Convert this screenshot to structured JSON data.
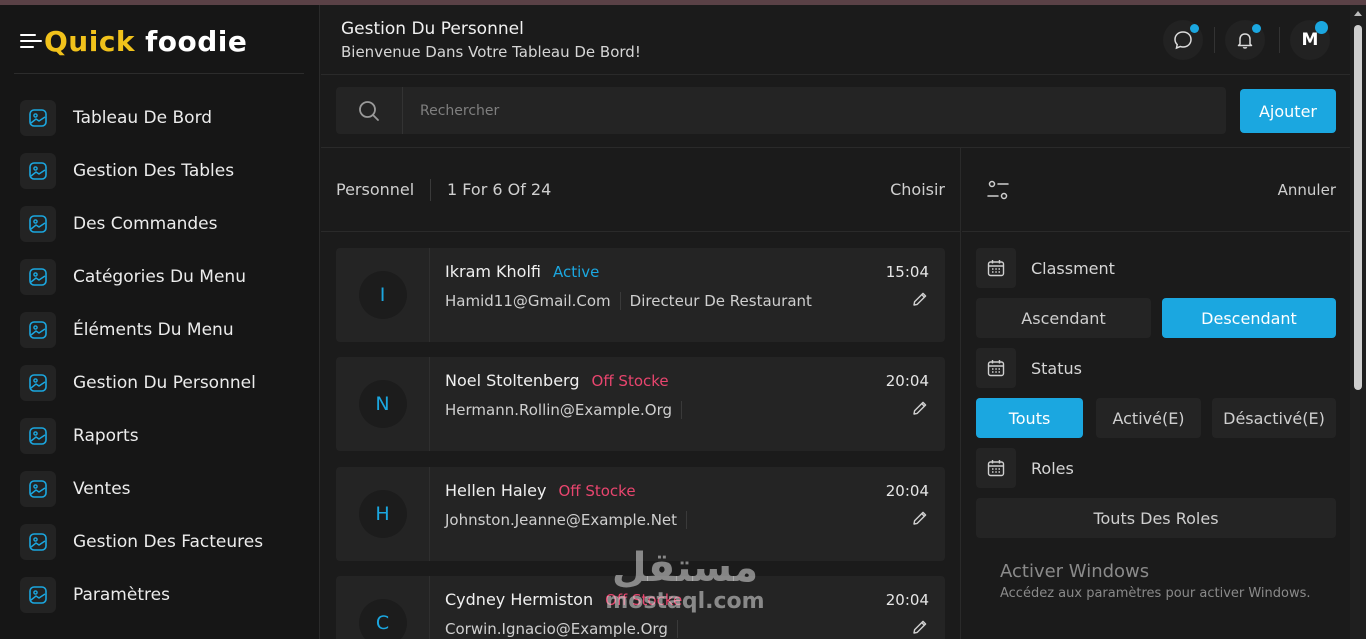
{
  "brand": {
    "part1": "Quick",
    "part2": "foodie"
  },
  "sidebar": {
    "items": [
      {
        "label": "Tableau De Bord"
      },
      {
        "label": "Gestion Des Tables"
      },
      {
        "label": "Des Commandes"
      },
      {
        "label": "Catégories Du Menu"
      },
      {
        "label": "Éléments Du Menu"
      },
      {
        "label": "Gestion Du Personnel"
      },
      {
        "label": "Raports"
      },
      {
        "label": "Ventes"
      },
      {
        "label": "Gestion Des Facteures"
      },
      {
        "label": "Paramètres"
      }
    ]
  },
  "header": {
    "title": "Gestion Du Personnel",
    "subtitle": "Bienvenue Dans Votre Tableau De Bord!",
    "avatar_letter": "M"
  },
  "search": {
    "placeholder": "Rechercher",
    "value": ""
  },
  "toolbar": {
    "add_label": "Ajouter"
  },
  "list": {
    "title": "Personnel",
    "count": "1 For 6 Of 24",
    "choose_label": "Choisir",
    "rows": [
      {
        "initial": "I",
        "name": "Ikram Kholfi",
        "status": "Active",
        "email": "Hamid11@Gmail.Com",
        "role": "Directeur De Restaurant",
        "time": "15:04"
      },
      {
        "initial": "N",
        "name": "Noel Stoltenberg",
        "status": "Off Stocke",
        "email": "Hermann.Rollin@Example.Org",
        "role": "",
        "time": "20:04"
      },
      {
        "initial": "H",
        "name": "Hellen Haley",
        "status": "Off Stocke",
        "email": "Johnston.Jeanne@Example.Net",
        "role": "",
        "time": "20:04"
      },
      {
        "initial": "C",
        "name": "Cydney Hermiston",
        "status": "Off Stocke",
        "email": "Corwin.Ignacio@Example.Org",
        "role": "",
        "time": "20:04"
      }
    ]
  },
  "filters": {
    "cancel_label": "Annuler",
    "sort": {
      "label": "Classment",
      "options": [
        "Ascendant",
        "Descendant"
      ],
      "selected": "Descendant"
    },
    "status": {
      "label": "Status",
      "options": [
        "Touts",
        "Activé(E)",
        "Désactivé(E)"
      ],
      "selected": "Touts"
    },
    "roles": {
      "label": "Roles",
      "selected": "Touts Des Roles"
    }
  },
  "system": {
    "activate_title": "Activer Windows",
    "activate_sub": "Accédez aux paramètres pour activer Windows."
  },
  "watermark": {
    "arabic": "مستقل",
    "latin": "mostaql.com"
  },
  "colors": {
    "accent": "#1ba7e0",
    "off_status": "#e8456e",
    "brand_yellow": "#f1c21b",
    "background": "#1b1b1b"
  }
}
